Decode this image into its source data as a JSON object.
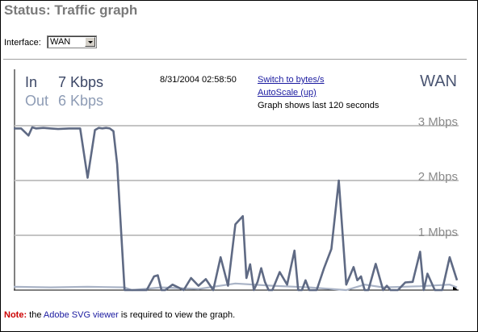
{
  "page": {
    "title": "Status: Traffic graph"
  },
  "interface_select": {
    "label": "Interface:",
    "value": "WAN"
  },
  "graph": {
    "in_label": "In",
    "in_value": "7 Kbps",
    "out_label": "Out",
    "out_value": "6 Kbps",
    "timestamp": "8/31/2004 02:58:50",
    "switch_link": "Switch to bytes/s",
    "autoscale_link": "AutoScale (up)",
    "info": "Graph shows last 120 seconds",
    "interface_name": "WAN",
    "axis_labels": [
      "3 Mbps",
      "2 Mbps",
      "1 Mbps"
    ],
    "colors": {
      "in": "#5f6a84",
      "out": "#a9b3c6",
      "grid": "#c4c4c4"
    }
  },
  "note": {
    "key": "Note:",
    "text_before": " the ",
    "link": "Adobe SVG viewer",
    "text_after": " is required to view the graph."
  },
  "chart_data": {
    "type": "line",
    "title": "",
    "xlabel": "",
    "ylabel": "",
    "ylim": [
      0,
      3
    ],
    "y_ticks": [
      "3 Mbps",
      "2 Mbps",
      "1 Mbps"
    ],
    "x_range_seconds": [
      0,
      120
    ],
    "grid": true,
    "series": [
      {
        "name": "In",
        "x": [
          0,
          2,
          4,
          5,
          6,
          8,
          10,
          12,
          15,
          18,
          20,
          22,
          23,
          24,
          25,
          26,
          27,
          28,
          30,
          32,
          34,
          36,
          38,
          39,
          40,
          41,
          43,
          46,
          48,
          50,
          52,
          54,
          56,
          58,
          60,
          62,
          63,
          64,
          65,
          66,
          67,
          68,
          69,
          70,
          72,
          74,
          76,
          77,
          78,
          79,
          80,
          82,
          84,
          86,
          88,
          90,
          92,
          93,
          94,
          95,
          96,
          98,
          100,
          101,
          102,
          103,
          104,
          106,
          108,
          110,
          111,
          112,
          114,
          116,
          118,
          120
        ],
        "values": [
          2.95,
          2.95,
          2.82,
          2.97,
          2.95,
          2.96,
          2.95,
          2.94,
          2.95,
          2.95,
          2.05,
          2.92,
          2.96,
          2.95,
          2.96,
          2.95,
          2.9,
          2.3,
          0.0,
          0.0,
          0.0,
          0.0,
          0.25,
          0.27,
          0.0,
          0.0,
          0.1,
          0.0,
          0.22,
          0.08,
          0.2,
          0.0,
          0.6,
          0.08,
          1.2,
          1.35,
          0.22,
          0.47,
          0.0,
          0.15,
          0.4,
          0.15,
          0.0,
          0.0,
          0.33,
          0.1,
          0.72,
          0.0,
          0.0,
          0.18,
          0.0,
          0.0,
          0.4,
          0.75,
          2.0,
          0.1,
          0.42,
          0.18,
          0.25,
          0.0,
          0.0,
          0.48,
          0.0,
          0.08,
          0.0,
          0.0,
          0.0,
          0.14,
          0.15,
          0.7,
          0.0,
          0.3,
          0.0,
          0.0,
          0.6,
          0.18
        ]
      },
      {
        "name": "Out",
        "x": [
          0,
          10,
          20,
          30,
          32,
          40,
          50,
          60,
          70,
          80,
          90,
          95,
          100,
          110,
          118,
          120
        ],
        "values": [
          0.06,
          0.05,
          0.06,
          0.05,
          0.0,
          0.05,
          0.02,
          0.12,
          0.08,
          0.05,
          0.0,
          0.1,
          0.05,
          0.07,
          0.1,
          0.05
        ]
      }
    ]
  }
}
